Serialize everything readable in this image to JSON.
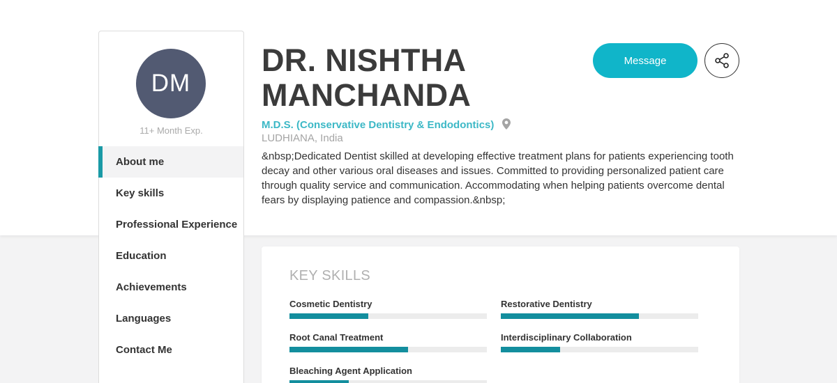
{
  "profile": {
    "initials": "DM",
    "experience": "11+ Month Exp.",
    "name_line1": "DR. NISHTHA",
    "name_line2": "MANCHANDA",
    "degree": "M.D.S. (Conservative Dentistry & Endodontics)",
    "location": "LUDHIANA, India",
    "bio": "&nbsp;Dedicated Dentist skilled at developing effective treatment plans for patients experiencing tooth decay and other various oral diseases and issues. Committed to providing personalized patient care through quality service and communication. Accommodating when helping patients overcome dental fears by displaying patience and compassion.&nbsp;"
  },
  "actions": {
    "message_label": "Message",
    "share_icon": "share-icon"
  },
  "nav": {
    "items": [
      {
        "label": "About me",
        "active": true
      },
      {
        "label": "Key skills",
        "active": false
      },
      {
        "label": "Professional Experience",
        "active": false
      },
      {
        "label": "Education",
        "active": false
      },
      {
        "label": "Achievements",
        "active": false
      },
      {
        "label": "Languages",
        "active": false
      },
      {
        "label": "Contact Me",
        "active": false
      }
    ]
  },
  "skills": {
    "title": "KEY SKILLS",
    "items": [
      {
        "label": "Cosmetic Dentistry",
        "level": 0.4
      },
      {
        "label": "Restorative Dentistry",
        "level": 0.7
      },
      {
        "label": "Root Canal Treatment",
        "level": 0.6
      },
      {
        "label": "Interdisciplinary Collaboration",
        "level": 0.3
      },
      {
        "label": "Bleaching Agent Application",
        "level": 0.3
      }
    ]
  },
  "colors": {
    "accent": "#10b5c9",
    "bar": "#138e9e",
    "avatar": "#525a72",
    "degree": "#3cb8c6"
  }
}
